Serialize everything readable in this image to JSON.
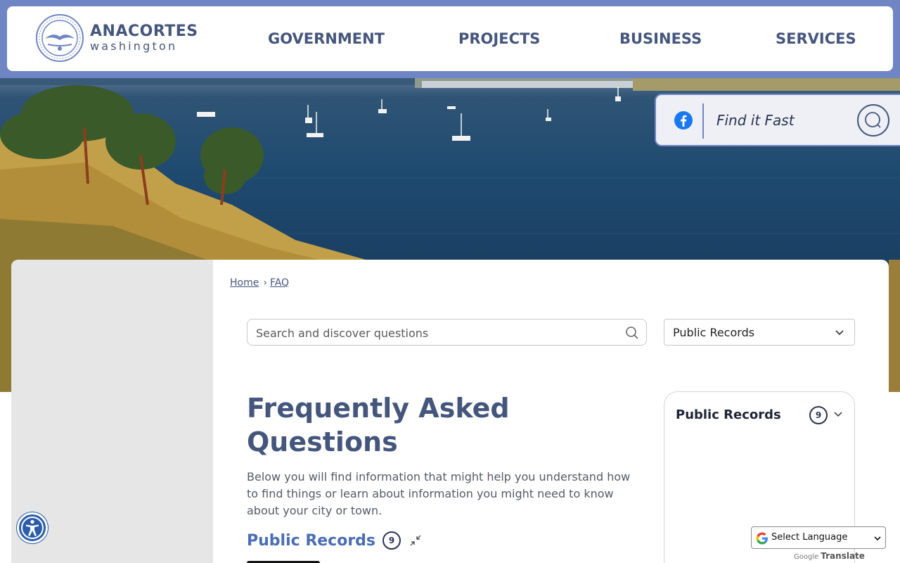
{
  "brand": {
    "title": "ANACORTES",
    "subtitle": "washington"
  },
  "nav": {
    "items": [
      "GOVERNMENT",
      "PROJECTS",
      "BUSINESS",
      "SERVICES"
    ]
  },
  "find": {
    "text": "Find it Fast"
  },
  "breadcrumb": {
    "home": "Home",
    "separator": "›",
    "current": "FAQ"
  },
  "search": {
    "placeholder": "Search and discover questions"
  },
  "category_select": {
    "value": "Public Records"
  },
  "main": {
    "title": "Frequently Asked Questions",
    "intro": "Below you will find information that might help you understand how to find things or learn about information you might need to know about your city or town."
  },
  "section": {
    "title": "Public Records",
    "count": "9"
  },
  "side_panel": {
    "title": "Public Records",
    "count": "9"
  },
  "translate": {
    "label": "Select Language",
    "powered_prefix": "Google",
    "powered_suffix": "Translate"
  },
  "colors": {
    "brand_blue": "#6f85c4",
    "navy": "#45567d",
    "link_blue": "#4a6db5",
    "a11y_blue": "#2b5ea8"
  }
}
